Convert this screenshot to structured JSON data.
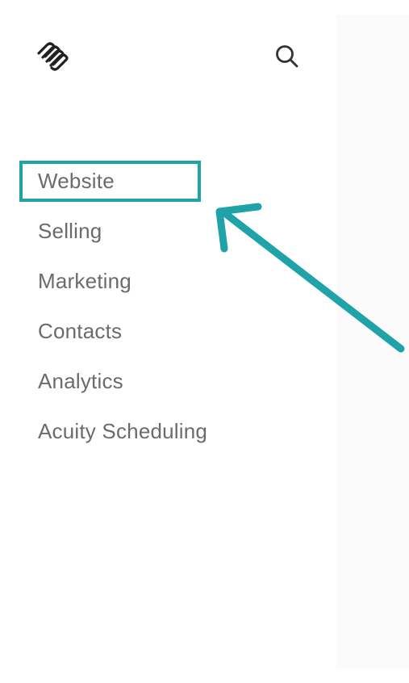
{
  "app": {
    "logo_icon": "squarespace-logo-icon",
    "search_icon": "search-icon"
  },
  "sidebar": {
    "items": [
      {
        "label": "Website",
        "highlighted": true
      },
      {
        "label": "Selling",
        "highlighted": false
      },
      {
        "label": "Marketing",
        "highlighted": false
      },
      {
        "label": "Contacts",
        "highlighted": false
      },
      {
        "label": "Analytics",
        "highlighted": false
      },
      {
        "label": "Acuity Scheduling",
        "highlighted": false
      }
    ]
  },
  "annotation": {
    "highlight_color": "#1fa3a8",
    "arrow_color": "#1fa3a8",
    "arrow_target": "Website"
  },
  "colors": {
    "nav_text": "#6b6b6b",
    "icon": "#333333",
    "right_pane_bg": "#fbfbfb"
  }
}
